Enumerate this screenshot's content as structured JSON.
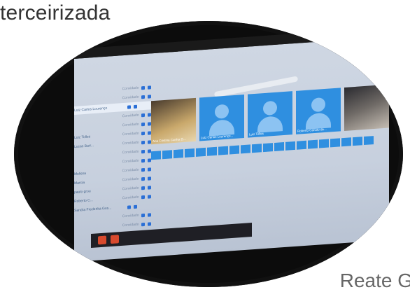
{
  "slide": {
    "title": "terceirizada",
    "footer": "Reate G"
  },
  "sidebar": {
    "participants": [
      {
        "name": "",
        "role": "Convidado"
      },
      {
        "name": "",
        "role": "Convidado"
      },
      {
        "name": "Luiz Carlos Lourenço",
        "role": ""
      },
      {
        "name": "",
        "role": "Convidado"
      },
      {
        "name": "",
        "role": "Convidado"
      },
      {
        "name": "Luiz Tolles",
        "role": "Convidado"
      },
      {
        "name": "Lucas Barr...",
        "role": "Convidado"
      },
      {
        "name": "",
        "role": "Convidado"
      },
      {
        "name": "",
        "role": "Convidado"
      },
      {
        "name": "Melissa",
        "role": "Convidado"
      },
      {
        "name": "Marcia",
        "role": "Convidado"
      },
      {
        "name": "paulo grou",
        "role": "Convidado"
      },
      {
        "name": "Roberto C...",
        "role": "Convidado"
      },
      {
        "name": "Sandra Frederika Gus...",
        "role": ""
      },
      {
        "name": "",
        "role": "Convidado"
      },
      {
        "name": "",
        "role": "Convidado"
      }
    ]
  },
  "tiles": [
    {
      "label": "Ana Cristina Cunha Zi..."
    },
    {
      "label": "Luiz Carlos Lourenço..."
    },
    {
      "label": "Luiz Tolles"
    },
    {
      "label": "Roberto Canuto de..."
    },
    {
      "label": ""
    }
  ]
}
